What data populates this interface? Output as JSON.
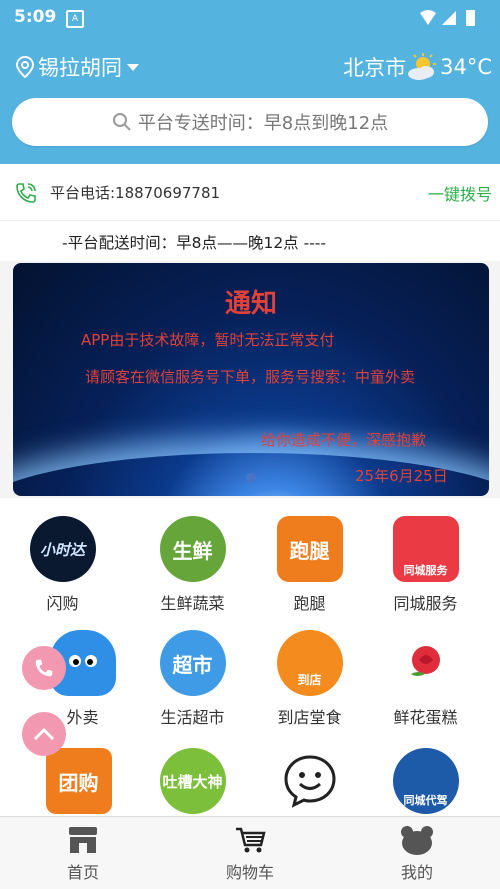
{
  "statusbar": {
    "time": "5:09",
    "notif": "A"
  },
  "header": {
    "location": "锡拉胡同",
    "city": "北京市",
    "temperature": "34°C"
  },
  "search": {
    "text": "平台专送时间：早8点到晚12点"
  },
  "phone": {
    "label": "平台电话:18870697781",
    "dial": "一键拨号"
  },
  "delivery": {
    "text": "-平台配送时间：早8点——晚12点 ----"
  },
  "banner": {
    "title": "通知",
    "line1": "APP由于技术故障，暂时无法正常支付",
    "line2": "请顾客在微信服务号下单，服务号搜索：中童外卖",
    "line3": "给你造成不便，深感抱歉",
    "date": "25年6月25日"
  },
  "services": [
    {
      "label": "闪购",
      "icon_text": "小时达",
      "color": "#0a1830"
    },
    {
      "label": "生鲜蔬菜",
      "icon_text": "生鲜",
      "color": "#66a53a"
    },
    {
      "label": "跑腿",
      "icon_text": "跑腿",
      "color": "#f07d1d"
    },
    {
      "label": "同城服务",
      "icon_text": "同城服务",
      "color": "#ea3b45"
    },
    {
      "label": "外卖",
      "icon_text": "",
      "color": "#2f8fe6"
    },
    {
      "label": "生活超市",
      "icon_text": "超市",
      "color": "#3f9be6"
    },
    {
      "label": "到店堂食",
      "icon_text": "到店",
      "color": "#f38b1e"
    },
    {
      "label": "鲜花蛋糕",
      "icon_text": "",
      "color": "#e02d3c"
    },
    {
      "label": "",
      "icon_text": "团购",
      "color": "#f07d1d"
    },
    {
      "label": "",
      "icon_text": "吐槽大神",
      "color": "#7bbf3b"
    },
    {
      "label": "",
      "icon_text": "",
      "color": "#ffffff"
    },
    {
      "label": "",
      "icon_text": "同城代驾",
      "color": "#1d5aa8"
    }
  ],
  "tabs": [
    {
      "label": "首页"
    },
    {
      "label": "购物车"
    },
    {
      "label": "我的"
    }
  ]
}
